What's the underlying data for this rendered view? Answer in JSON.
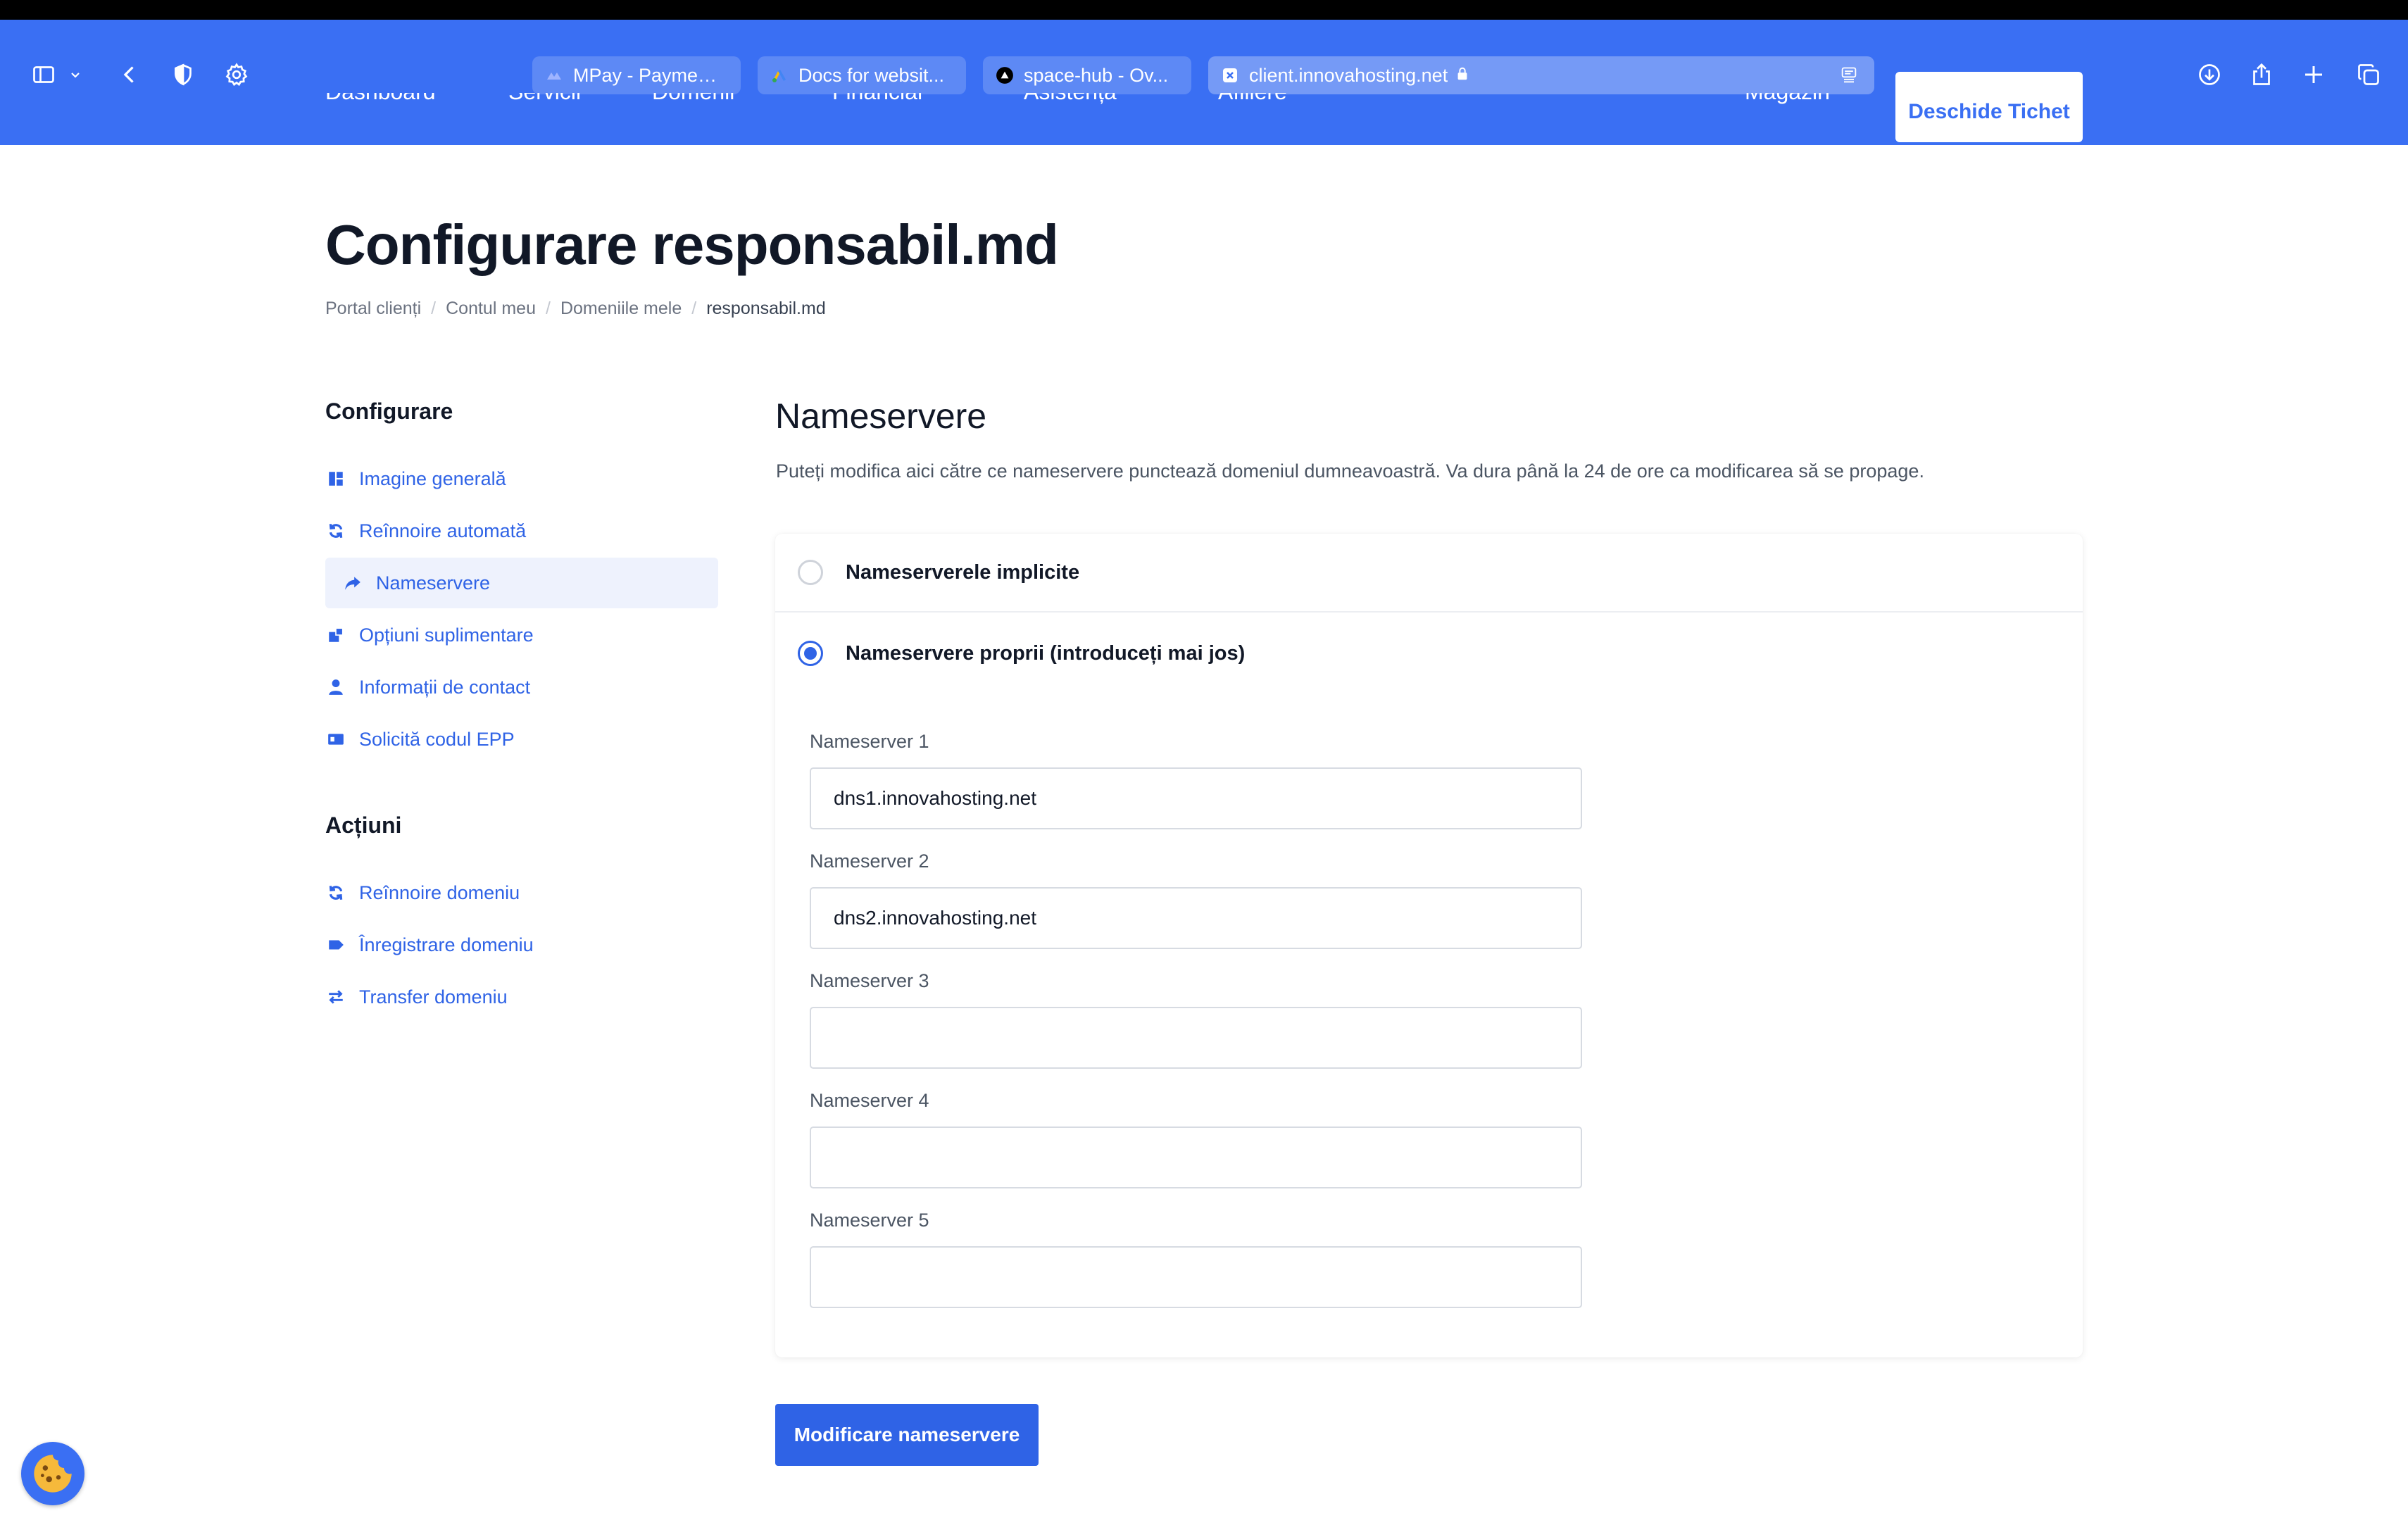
{
  "browser": {
    "tabs": [
      {
        "label": "MPay - Payment..."
      },
      {
        "label": "Docs for websit..."
      },
      {
        "label": "space-hub - Ov..."
      },
      {
        "label": "client.innovahosting.net"
      }
    ]
  },
  "site_nav": {
    "items": [
      "Dashboard",
      "Servicii",
      "Domenii",
      "Financiar",
      "Asistența",
      "Afiliere"
    ],
    "shop": "Magazin",
    "ticket": "Deschide Tichet"
  },
  "page": {
    "title": "Configurare responsabil.md",
    "breadcrumb": [
      "Portal clienți",
      "Contul meu",
      "Domeniile mele",
      "responsabil.md"
    ]
  },
  "sidebar": {
    "config_heading": "Configurare",
    "config_items": [
      {
        "label": "Imagine generală",
        "icon": "dashboard-icon"
      },
      {
        "label": "Reînnoire automată",
        "icon": "sync-icon"
      },
      {
        "label": "Nameservere",
        "icon": "share-arrow-icon"
      },
      {
        "label": "Opțiuni suplimentare",
        "icon": "addons-icon"
      },
      {
        "label": "Informații de contact",
        "icon": "user-icon"
      },
      {
        "label": "Solicită codul EPP",
        "icon": "id-card-icon"
      }
    ],
    "actions_heading": "Acțiuni",
    "action_items": [
      {
        "label": "Reînnoire domeniu",
        "icon": "sync-icon"
      },
      {
        "label": "Înregistrare domeniu",
        "icon": "tag-icon"
      },
      {
        "label": "Transfer domeniu",
        "icon": "transfer-icon"
      }
    ]
  },
  "nameservers": {
    "title": "Nameservere",
    "description": "Puteți modifica aici către ce nameservere punctează domeniul dumneavoastră. Va dura până la 24 de ore ca modificarea să se propage.",
    "option_default": "Nameserverele implicite",
    "option_custom": "Nameservere proprii (introduceți mai jos)",
    "fields": [
      {
        "label": "Nameserver 1",
        "value": "dns1.innovahosting.net"
      },
      {
        "label": "Nameserver 2",
        "value": "dns2.innovahosting.net"
      },
      {
        "label": "Nameserver 3",
        "value": ""
      },
      {
        "label": "Nameserver 4",
        "value": ""
      },
      {
        "label": "Nameserver 5",
        "value": ""
      }
    ],
    "submit": "Modificare nameservere"
  },
  "colors": {
    "header": "#3a6ff3",
    "accent": "#2f63e6"
  }
}
